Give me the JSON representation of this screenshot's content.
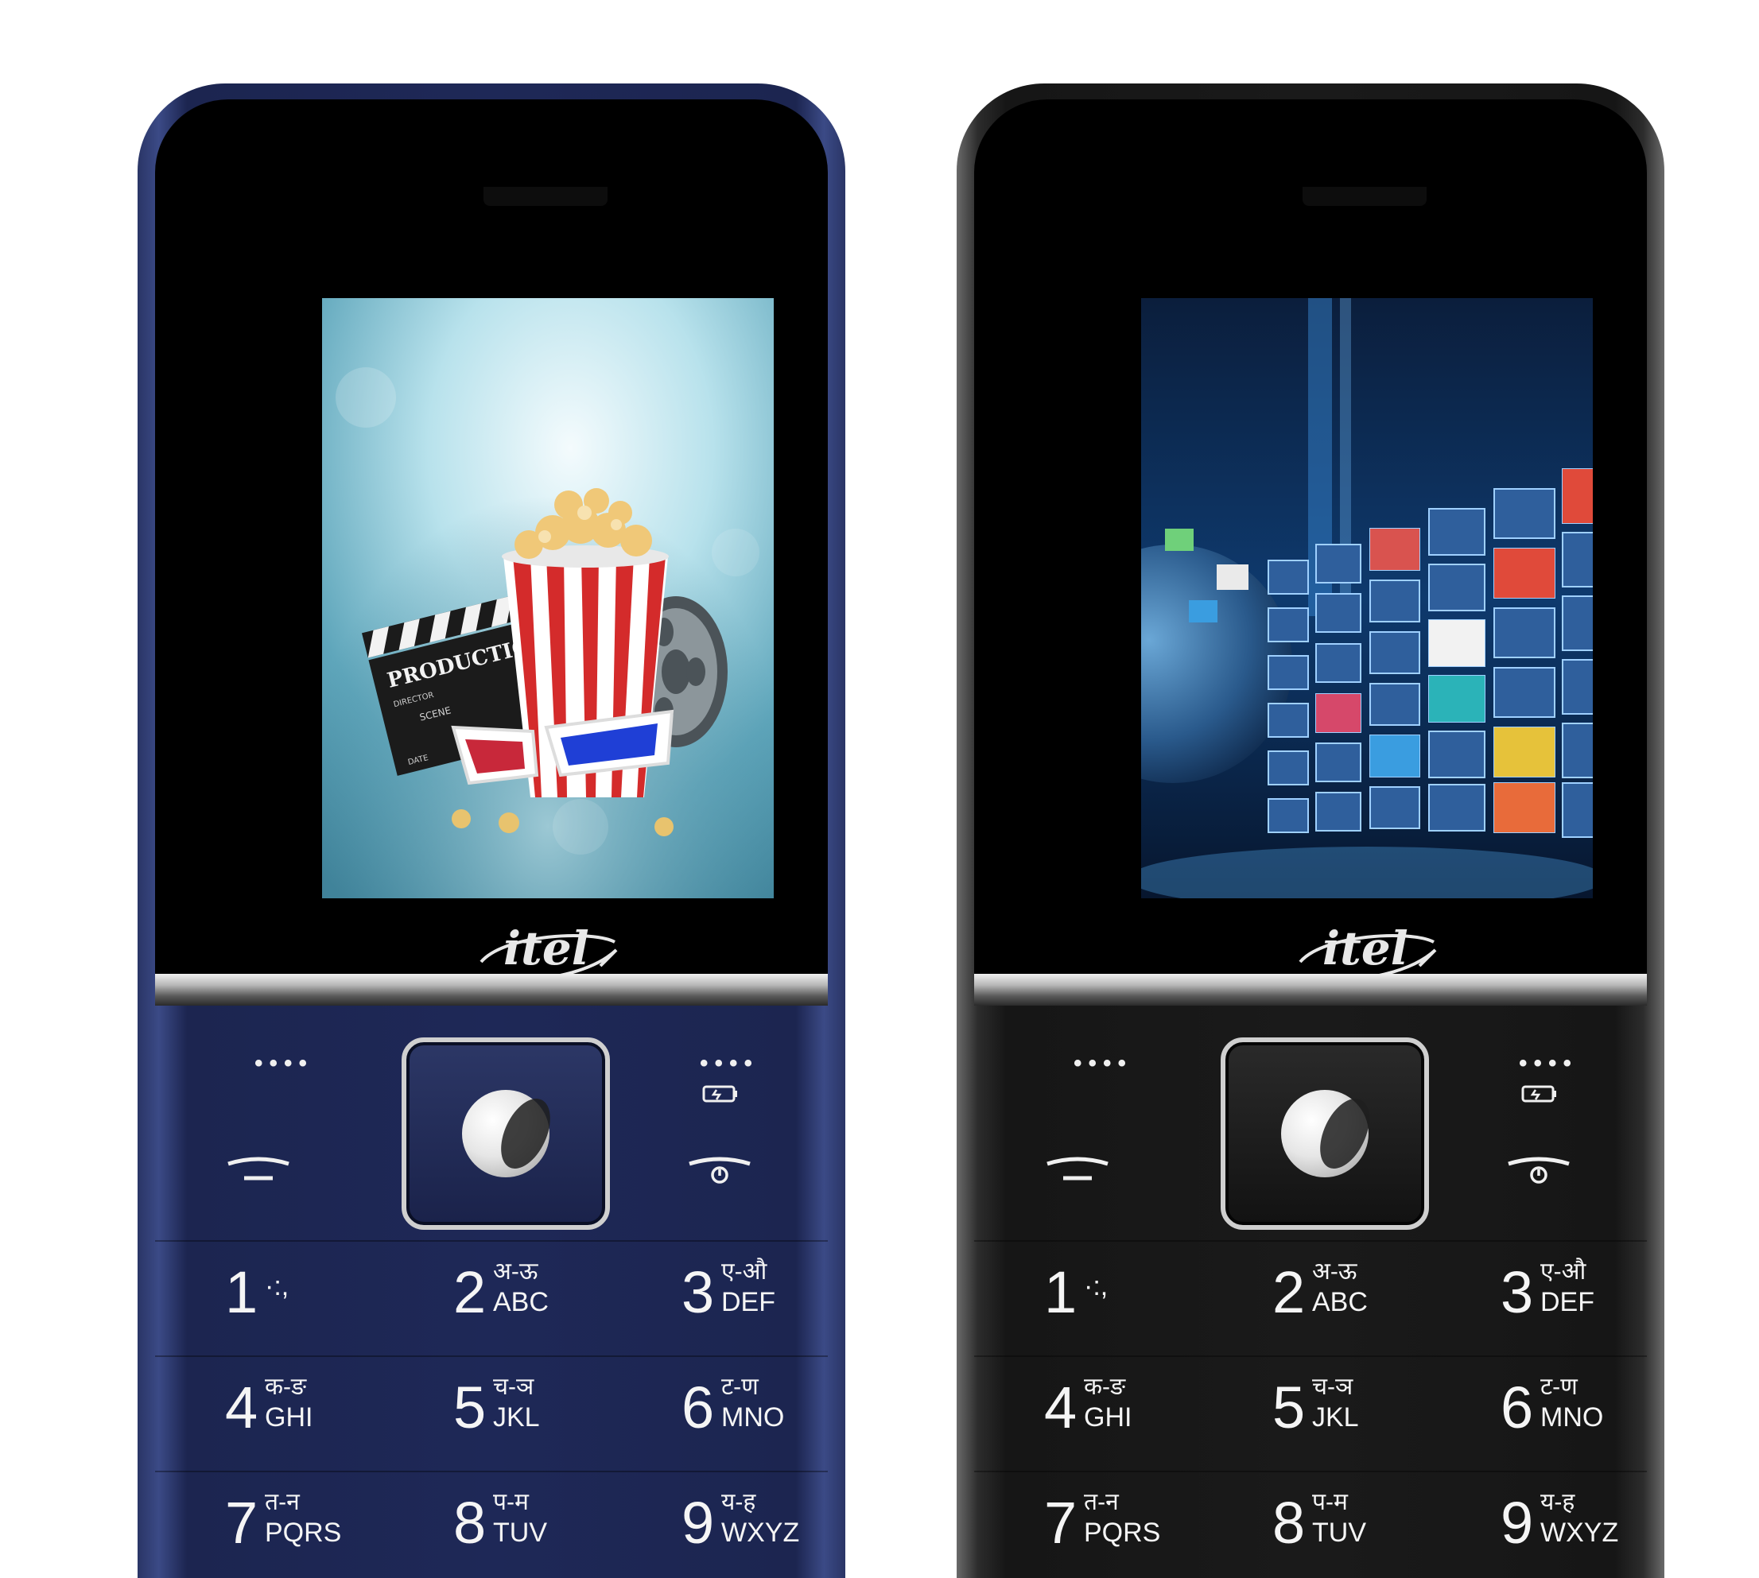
{
  "phones": [
    {
      "brand": "itel",
      "color": "#1e2857",
      "keys": [
        {
          "num": "1",
          "sub1": "",
          "sub2": "·:,"
        },
        {
          "num": "2",
          "sub1": "अ-ऊ",
          "sub2": "ABC"
        },
        {
          "num": "3",
          "sub1": "ए-औ",
          "sub2": "DEF"
        },
        {
          "num": "4",
          "sub1": "क-ङ",
          "sub2": "GHI"
        },
        {
          "num": "5",
          "sub1": "च-ञ",
          "sub2": "JKL"
        },
        {
          "num": "6",
          "sub1": "ट-ण",
          "sub2": "MNO"
        },
        {
          "num": "7",
          "sub1": "त-न",
          "sub2": "PQRS"
        },
        {
          "num": "8",
          "sub1": "प-म",
          "sub2": "TUV"
        },
        {
          "num": "9",
          "sub1": "य-ह",
          "sub2": "WXYZ"
        }
      ],
      "screen_content": {
        "clapper_text": "PRODUCTION",
        "clapper_sub1": "DIRECTOR",
        "clapper_sub2": "SCENE",
        "clapper_sub3": "DATE"
      }
    },
    {
      "brand": "itel",
      "color": "#1a1a1a",
      "keys": [
        {
          "num": "1",
          "sub1": "",
          "sub2": "·:,"
        },
        {
          "num": "2",
          "sub1": "अ-ऊ",
          "sub2": "ABC"
        },
        {
          "num": "3",
          "sub1": "ए-औ",
          "sub2": "DEF"
        },
        {
          "num": "4",
          "sub1": "क-ङ",
          "sub2": "GHI"
        },
        {
          "num": "5",
          "sub1": "च-ञ",
          "sub2": "JKL"
        },
        {
          "num": "6",
          "sub1": "ट-ण",
          "sub2": "MNO"
        },
        {
          "num": "7",
          "sub1": "त-न",
          "sub2": "PQRS"
        },
        {
          "num": "8",
          "sub1": "प-म",
          "sub2": "TUV"
        },
        {
          "num": "9",
          "sub1": "य-ह",
          "sub2": "WXYZ"
        }
      ]
    }
  ],
  "softkeys": {
    "left_dots": "••••",
    "right_dots": "••••"
  }
}
